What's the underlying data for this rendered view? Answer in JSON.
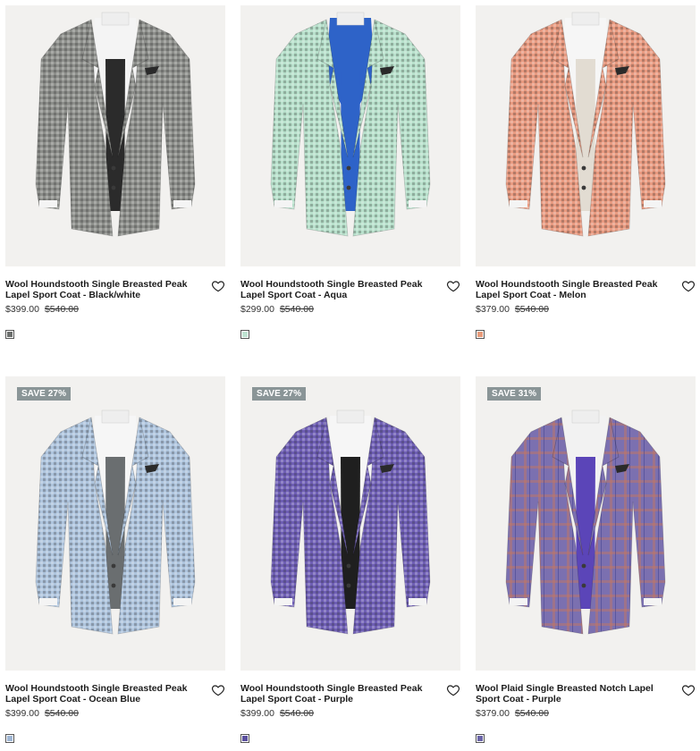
{
  "products": [
    {
      "title": "Wool Houndstooth Single Breasted Peak Lapel Sport Coat - Black/white",
      "price": "$399.00",
      "original_price": "$540.00",
      "badge": "",
      "swatch_color": "#6b6e6c",
      "jacket_color": "#8c8e8a",
      "shirt_color": "#f4f4f4",
      "inner_color": "#2b2b2b"
    },
    {
      "title": "Wool Houndstooth Single Breasted Peak Lapel Sport Coat - Aqua",
      "price": "$299.00",
      "original_price": "$540.00",
      "badge": "",
      "swatch_color": "#bfe3d2",
      "jacket_color": "#b7e0cb",
      "shirt_color": "#2e63c8",
      "inner_color": "#2e63c8"
    },
    {
      "title": "Wool Houndstooth Single Breasted Peak Lapel Sport Coat - Melon",
      "price": "$379.00",
      "original_price": "$540.00",
      "badge": "",
      "swatch_color": "#e79a7a",
      "jacket_color": "#e89a80",
      "shirt_color": "#f6f6f6",
      "inner_color": "#e2dcd2"
    },
    {
      "title": "Wool Houndstooth Single Breasted Peak Lapel Sport Coat - Ocean Blue",
      "price": "$399.00",
      "original_price": "$540.00",
      "badge": "SAVE 27%",
      "swatch_color": "#9fb6d4",
      "jacket_color": "#aec4dd",
      "shirt_color": "#f6f6f6",
      "inner_color": "#6a6e70"
    },
    {
      "title": "Wool Houndstooth Single Breasted Peak Lapel Sport Coat - Purple",
      "price": "$399.00",
      "original_price": "$540.00",
      "badge": "SAVE 27%",
      "swatch_color": "#5a4f9e",
      "jacket_color": "#6e5eb4",
      "shirt_color": "#f6f6f6",
      "inner_color": "#1f1f1f"
    },
    {
      "title": "Wool Plaid Single Breasted Notch Lapel Sport Coat - Purple",
      "price": "$379.00",
      "original_price": "$540.00",
      "badge": "SAVE 31%",
      "swatch_color": "#6a64a8",
      "jacket_color": "#7b70b0",
      "shirt_color": "#f2f2f2",
      "inner_color": "#5b45b8"
    }
  ],
  "icons": {
    "wishlist": "heart-outline-icon"
  }
}
